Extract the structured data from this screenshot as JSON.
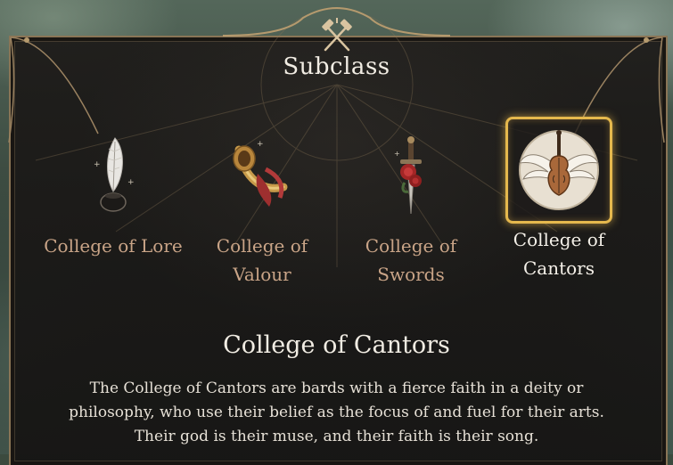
{
  "panel": {
    "title": "Subclass"
  },
  "subclasses": [
    {
      "label": "College of Lore",
      "icon": "quill-inkwell-icon",
      "selected": false
    },
    {
      "label": "College of Valour",
      "icon": "war-horn-icon",
      "selected": false
    },
    {
      "label": "College of Swords",
      "icon": "dagger-rose-icon",
      "selected": false
    },
    {
      "label": "College of Cantors",
      "icon": "winged-violin-icon",
      "selected": true
    }
  ],
  "description": {
    "title": "College of Cantors",
    "text": "The College of Cantors are bards with a fierce faith in a deity or philosophy, who use their belief as the focus of and fuel for their arts. Their god is their muse, and their faith is their song."
  },
  "colors": {
    "selection_border": "#e5b84d",
    "label_unselected": "#c9a487",
    "label_selected": "#f4f0e8",
    "frame": "#8a7556"
  }
}
